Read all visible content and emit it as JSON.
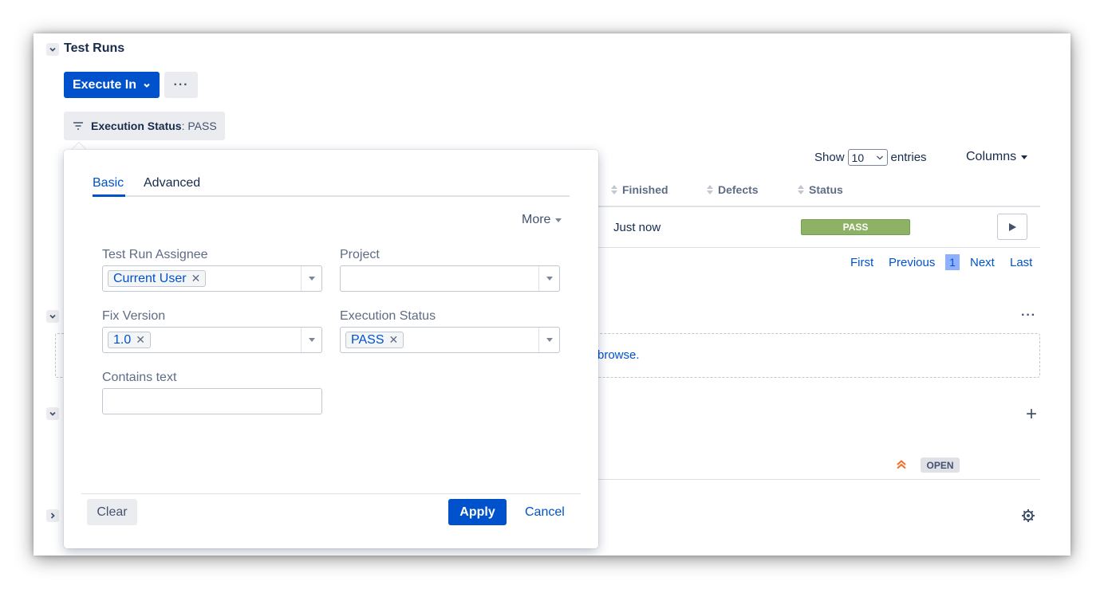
{
  "section_test_runs": {
    "title": "Test Runs"
  },
  "toolbar": {
    "execute_label": "Execute In",
    "more_label": "···"
  },
  "filter_chip": {
    "label": "Execution Status",
    "value": ": PASS"
  },
  "table_controls": {
    "show_label": "Show",
    "entries_value": "10",
    "entries_label": "entries",
    "columns_label": "Columns"
  },
  "table": {
    "headers": [
      "Finished",
      "Defects",
      "Status"
    ],
    "row": {
      "finished": "Just now",
      "status": "PASS"
    }
  },
  "pagination": {
    "first": "First",
    "previous": "Previous",
    "current": "1",
    "next": "Next",
    "last": "Last"
  },
  "section_2": {
    "link_text": "browse.",
    "more_label": "···"
  },
  "section_3": {
    "add_label": "+",
    "badge": "OPEN"
  },
  "popup": {
    "tabs": [
      "Basic",
      "Advanced"
    ],
    "more_label": "More",
    "fields": {
      "assignee": {
        "label": "Test Run Assignee",
        "tag": "Current User"
      },
      "project": {
        "label": "Project"
      },
      "fix_version": {
        "label": "Fix Version",
        "tag": "1.0"
      },
      "execution_status": {
        "label": "Execution Status",
        "tag": "PASS"
      },
      "contains_text": {
        "label": "Contains text",
        "value": ""
      }
    },
    "clear_label": "Clear",
    "apply_label": "Apply",
    "cancel_label": "Cancel"
  },
  "colors": {
    "primary": "#0052cc",
    "pass": "#8db265",
    "priority": "#f26f2a"
  }
}
